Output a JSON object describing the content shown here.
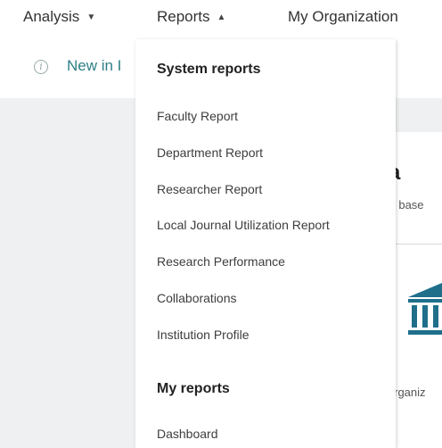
{
  "topnav": {
    "analysis": "Analysis",
    "reports": "Reports",
    "my_org": "My Organization"
  },
  "banner": {
    "text": "New in I"
  },
  "background_card": {
    "heading": "ta",
    "subtext": "ns base",
    "org_text": "Organiz"
  },
  "dropdown": {
    "system_heading": "System reports",
    "system_items": [
      "Faculty Report",
      "Department Report",
      "Researcher Report",
      "Local Journal Utilization Report",
      "Research Performance",
      "Collaborations",
      "Institution Profile"
    ],
    "my_heading": "My reports",
    "my_items": [
      "Dashboard"
    ]
  },
  "colors": {
    "accent_teal": "#2d7f86",
    "icon_blue": "#1f6f8b",
    "background_gray": "#eef0f1"
  }
}
